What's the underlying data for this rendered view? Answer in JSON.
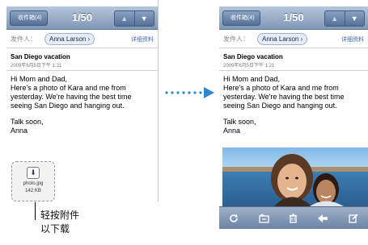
{
  "mail": {
    "back_label": "收件箱(4)",
    "counter": "1/50",
    "from_label": "发件人：",
    "sender": "Anna Larson",
    "details_link": "详细资料",
    "subject": "San Diego vacation",
    "date": "2009年6月5日下午 1:21",
    "body_lines": [
      "Hi Mom and Dad,",
      "Here's a photo of Kara and me from yesterday. We're having the best time seeing San Diego and hanging out.",
      "Talk soon,",
      "Anna"
    ]
  },
  "attachment": {
    "name": "photo.jpg",
    "size": "142 KB"
  },
  "toolbar": {
    "icons": [
      "refresh-icon",
      "folder-move-icon",
      "trash-icon",
      "reply-icon",
      "compose-icon"
    ]
  },
  "callout": {
    "line1": "轻按附件",
    "line2": "以下载"
  },
  "colors": {
    "navbar": "#7f97b7",
    "link": "#3e66b2",
    "connector": "#2f86c8"
  }
}
